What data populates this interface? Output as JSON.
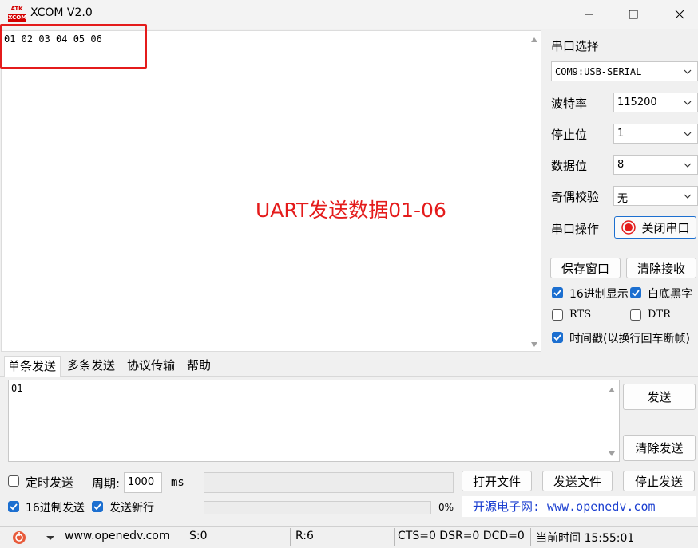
{
  "window": {
    "title": "XCOM V2.0",
    "icon_text_top": "ATK",
    "icon_text_bottom": "XCOM"
  },
  "receive": {
    "text": "01 02 03 04 05 06",
    "overlay_annotation": "UART发送数据01-06"
  },
  "serial": {
    "port_label": "串口选择",
    "port_value": "COM9:USB-SERIAL",
    "baud_label": "波特率",
    "baud_value": "115200",
    "stop_label": "停止位",
    "stop_value": "1",
    "data_label": "数据位",
    "data_value": "8",
    "parity_label": "奇偶校验",
    "parity_value": "无",
    "op_label": "串口操作",
    "op_button": "关闭串口",
    "status_color": "#e41b1b"
  },
  "receive_options": {
    "save_window": "保存窗口",
    "clear_receive": "清除接收",
    "hex_display": {
      "label": "16进制显示",
      "checked": true
    },
    "white_bg": {
      "label": "白底黑字",
      "checked": true
    },
    "rts": {
      "label": "RTS",
      "checked": false
    },
    "dtr": {
      "label": "DTR",
      "checked": false
    },
    "timestamp": {
      "label": "时间戳(以换行回车断帧)",
      "checked": true
    }
  },
  "tabs": [
    "单条发送",
    "多条发送",
    "协议传输",
    "帮助"
  ],
  "send": {
    "text": "01",
    "send_button": "发送",
    "clear_send_button": "清除发送"
  },
  "bottom": {
    "timed_send": {
      "label": "定时发送",
      "checked": false
    },
    "period_label": "周期:",
    "period_value": "1000",
    "period_unit": "ms",
    "open_file": "打开文件",
    "send_file": "发送文件",
    "stop_send": "停止发送",
    "hex_send": {
      "label": "16进制发送",
      "checked": true
    },
    "send_newline": {
      "label": "发送新行",
      "checked": true
    },
    "progress_percent": 0,
    "progress_text": "0%",
    "website_banner": "开源电子网: www.openedv.com"
  },
  "statusbar": {
    "url": "www.openedv.com",
    "sent": "S:0",
    "received": "R:6",
    "lines": "CTS=0 DSR=0 DCD=0",
    "time": "当前时间 15:55:01"
  },
  "colors": {
    "accent": "#1c6fd0",
    "annotation_red": "#e41b1b",
    "website_blue": "#1b3fd0"
  }
}
